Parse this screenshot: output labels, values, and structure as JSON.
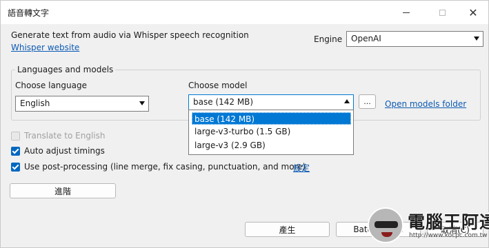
{
  "window": {
    "title": "語音轉文字",
    "controls": {
      "minimize": "",
      "maximize": "",
      "close": "✕"
    }
  },
  "header": {
    "description": "Generate text from audio via Whisper speech recognition",
    "website_link": "Whisper website",
    "engine_label": "Engine",
    "engine_value": "OpenAI"
  },
  "languages_models": {
    "group_title": "Languages and models",
    "language_label": "Choose language",
    "language_value": "English",
    "model_label": "Choose model",
    "model_value": "base (142 MB)",
    "model_options": [
      "base (142 MB)",
      "large-v3-turbo (1.5 GB)",
      "large-v3 (2.9 GB)"
    ],
    "browse_label": "...",
    "open_models_folder": "Open models folder"
  },
  "options": {
    "translate_label": "Translate to English",
    "translate_checked": false,
    "auto_adjust_label": "Auto adjust timings",
    "auto_adjust_checked": true,
    "post_processing_label": "Use post-processing (line merge, fix casing, punctuation, and more)",
    "post_processing_checked": true,
    "settings_link": "設定"
  },
  "buttons": {
    "advanced": "進階",
    "generate": "產生",
    "batch_mode": "Batch mode",
    "cancel": "取消(C)"
  },
  "watermark": {
    "title": "電腦王阿達",
    "url": "http://www.kocpc.com.tw"
  },
  "colors": {
    "accent": "#0078d4",
    "checkbox": "#0067c0",
    "link": "#0b5ab3"
  }
}
